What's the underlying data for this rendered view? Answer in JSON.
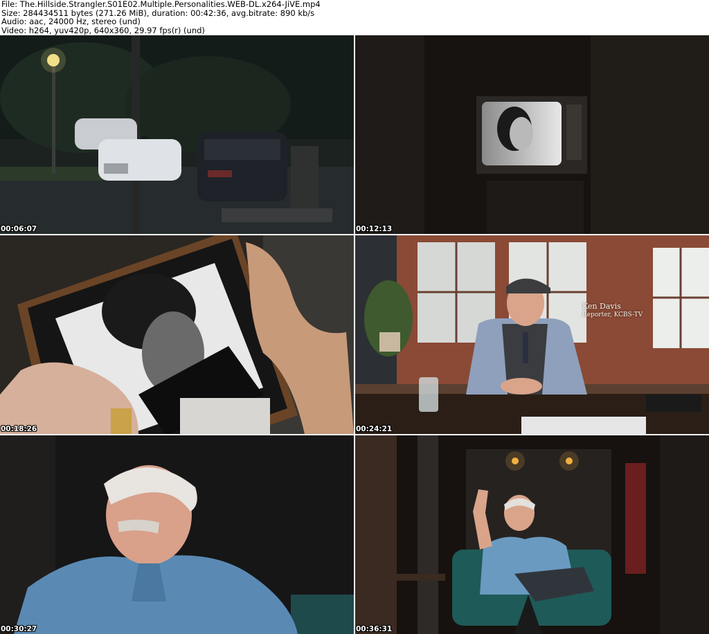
{
  "header": {
    "file_line": "File: The.Hillside.Strangler.S01E02.Multiple.Personalities.WEB-DL.x264-JiVE.mp4",
    "size_line": "Size: 284434511 bytes (271.26 MiB), duration: 00:42:36, avg.bitrate: 890 kb/s",
    "audio_line": "Audio: aac, 24000 Hz, stereo (und)",
    "video_line": "Video: h264, yuv420p, 640x360, 29.97 fps(r) (und)"
  },
  "frames": [
    {
      "timestamp": "00:06:07"
    },
    {
      "timestamp": "00:12:13"
    },
    {
      "timestamp": "00:18:26"
    },
    {
      "timestamp": "00:24:21",
      "lower_third": {
        "name": "Ken Davis",
        "role": "Reporter, KCBS-TV"
      }
    },
    {
      "timestamp": "00:30:27"
    },
    {
      "timestamp": "00:36:31"
    }
  ]
}
